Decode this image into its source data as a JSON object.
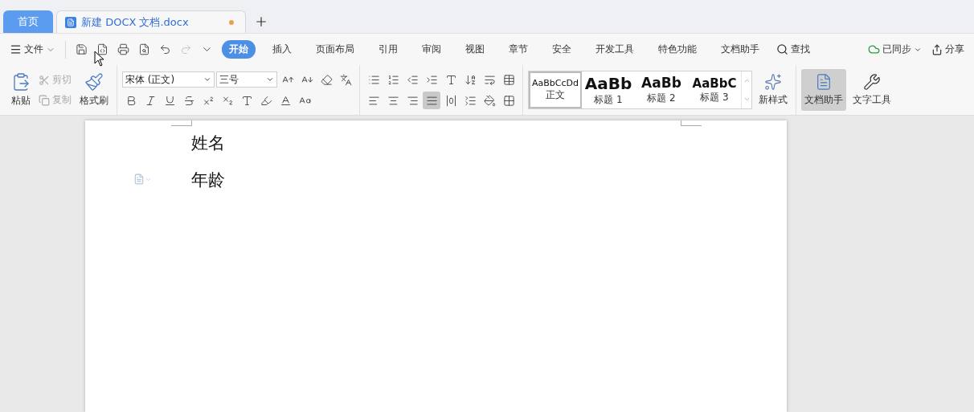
{
  "tabs": [
    {
      "label": "首页",
      "kind": "home",
      "selected": false
    },
    {
      "label": "新建 DOCX 文档.docx",
      "kind": "document",
      "selected": true,
      "modified": true
    }
  ],
  "menu": {
    "file": "文件",
    "redo": {
      "disabled": true
    },
    "ribbon_tabs": [
      {
        "label": "开始",
        "selected": true
      },
      {
        "label": "插入",
        "selected": false
      },
      {
        "label": "页面布局",
        "selected": false
      },
      {
        "label": "引用",
        "selected": false
      },
      {
        "label": "审阅",
        "selected": false
      },
      {
        "label": "视图",
        "selected": false
      },
      {
        "label": "章节",
        "selected": false
      },
      {
        "label": "安全",
        "selected": false
      },
      {
        "label": "开发工具",
        "selected": false
      },
      {
        "label": "特色功能",
        "selected": false
      },
      {
        "label": "文档助手",
        "selected": false
      }
    ],
    "search": "查找",
    "sync": "已同步",
    "share": "分享"
  },
  "clipboard": {
    "paste": "粘贴",
    "cut": {
      "label": "剪切",
      "disabled": true
    },
    "copy": {
      "label": "复制",
      "disabled": true
    },
    "format_painter": "格式刷"
  },
  "font": {
    "name": "宋体 (正文)",
    "size": "三号"
  },
  "alignment": [
    {
      "kind": "left",
      "selected": false
    },
    {
      "kind": "center",
      "selected": false
    },
    {
      "kind": "right",
      "selected": false
    },
    {
      "kind": "justify",
      "selected": true
    },
    {
      "kind": "distributed",
      "selected": false
    }
  ],
  "styles": [
    {
      "preview": "AaBbCcDd",
      "label": "正文",
      "kind": "body",
      "selected": true
    },
    {
      "preview": "AaBb",
      "label": "标题 1",
      "kind": "h1",
      "selected": false
    },
    {
      "preview": "AaBb",
      "label": "标题 2",
      "kind": "h2",
      "selected": false
    },
    {
      "preview": "AaBbC",
      "label": "标题 3",
      "kind": "h3",
      "selected": false
    }
  ],
  "new_style": "新样式",
  "assistant": {
    "label": "文档助手",
    "selected": true
  },
  "text_tools": "文字工具",
  "document": {
    "paragraphs": [
      "姓名",
      "年龄"
    ]
  }
}
